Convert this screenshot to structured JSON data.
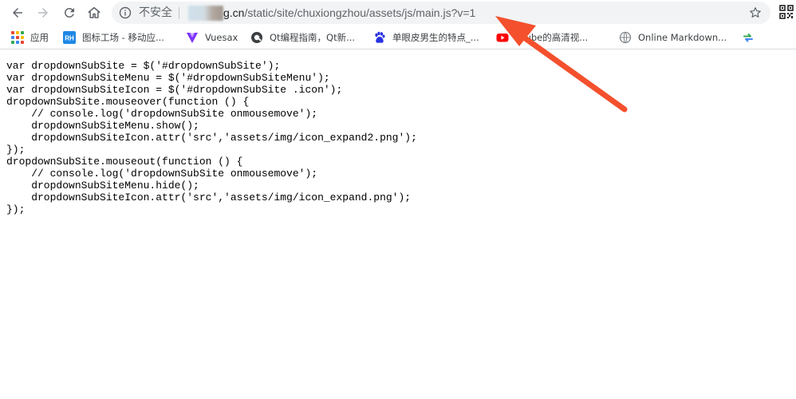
{
  "browser": {
    "security_label": "不安全",
    "url_host": "g.cn",
    "url_path": "/static/site/chuxiongzhou/assets/js/main.js?v=1"
  },
  "bookmarks": [
    {
      "label": "应用",
      "icon": "apps-grid-icon"
    },
    {
      "label": "图标工场 - 移动应...",
      "icon": "rh-logo-icon",
      "badge": "RH"
    },
    {
      "label": "Vuesax",
      "icon": "vuesax-logo-icon"
    },
    {
      "label": "Qt编程指南，Qt新...",
      "icon": "qt-site-icon"
    },
    {
      "label": "单眼皮男生的特点_...",
      "icon": "baidu-paw-icon"
    },
    {
      "label": "uTube的高清视...",
      "icon": "youtube-icon"
    },
    {
      "label": "Online Markdown...",
      "icon": "markdown-site-icon"
    },
    {
      "label": "",
      "icon": "sync-arrows-icon"
    }
  ],
  "code_lines": [
    "var dropdownSubSite = $('#dropdownSubSite');",
    "var dropdownSubSiteMenu = $('#dropdownSubSiteMenu');",
    "var dropdownSubSiteIcon = $('#dropdownSubSite .icon');",
    "dropdownSubSite.mouseover(function () {",
    "    // console.log('dropdownSubSite onmousemove');",
    "    dropdownSubSiteMenu.show();",
    "    dropdownSubSiteIcon.attr('src','assets/img/icon_expand2.png');",
    "});",
    "dropdownSubSite.mouseout(function () {",
    "    // console.log('dropdownSubSite onmousemove');",
    "    dropdownSubSiteMenu.hide();",
    "    dropdownSubSiteIcon.attr('src','assets/img/icon_expand.png');",
    "});"
  ],
  "colors": {
    "annotation_arrow": "#f4502d",
    "omnibox_bg": "#f1f3f4",
    "rh_badge": "#1e88e5",
    "youtube_red": "#ff0000",
    "baidu_blue": "#2932e1",
    "vuesax_purple": "#7d33ff"
  }
}
